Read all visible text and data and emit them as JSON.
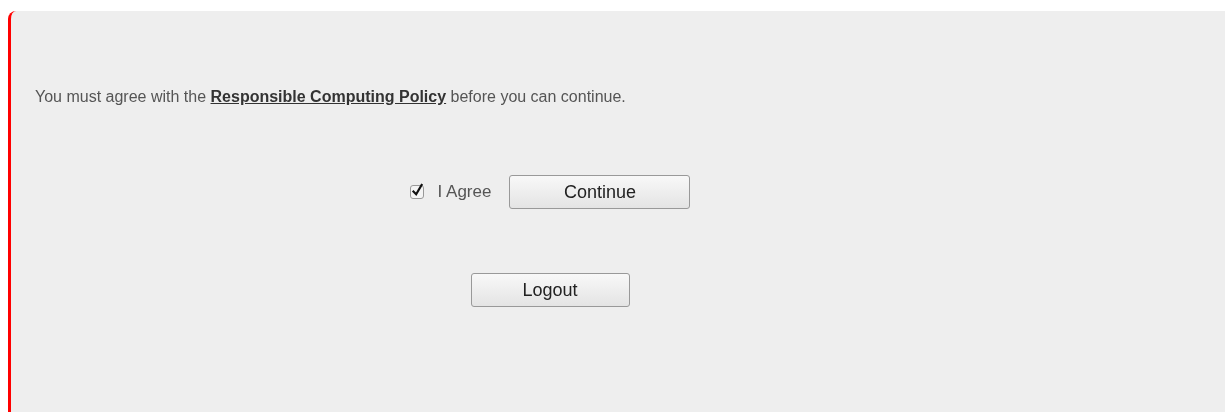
{
  "notice": {
    "before": "You must agree with the",
    "link": "Responsible Computing Policy",
    "after": "before you can continue."
  },
  "agree": {
    "label": "I Agree",
    "checked": true
  },
  "continue_button": "Continue",
  "logout_button": "Logout"
}
